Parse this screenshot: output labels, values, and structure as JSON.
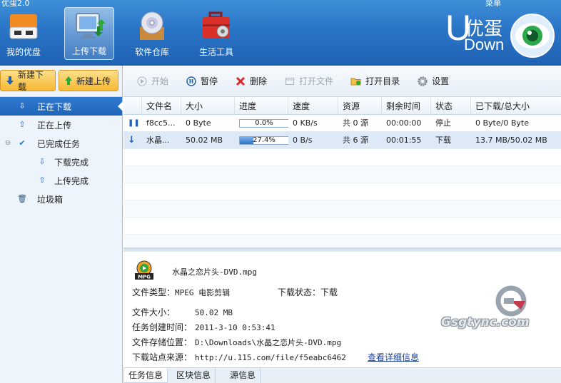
{
  "app": {
    "title": "优蛋2.0",
    "menu_label": "菜单"
  },
  "nav": [
    {
      "label": "我的优盘",
      "icon": "usb-drive-icon"
    },
    {
      "label": "上传下载",
      "icon": "monitor-transfer-icon",
      "active": true
    },
    {
      "label": "软件仓库",
      "icon": "disc-box-icon"
    },
    {
      "label": "生活工具",
      "icon": "toolbox-icon"
    }
  ],
  "logo": {
    "u": "U",
    "cn": "优蛋",
    "down": "Down"
  },
  "left": {
    "new_download": "新建下载",
    "new_upload": "新建上传",
    "tree": [
      {
        "label": "正在下载",
        "icon": "download-arrow-icon",
        "selected": true
      },
      {
        "label": "正在上传",
        "icon": "upload-arrow-icon"
      },
      {
        "label": "已完成任务",
        "icon": "check-icon"
      },
      {
        "label": "下载完成",
        "icon": "download-done-icon"
      },
      {
        "label": "上传完成",
        "icon": "upload-done-icon"
      },
      {
        "label": "垃圾箱",
        "icon": "trash-icon"
      }
    ]
  },
  "toolbar": {
    "start": "开始",
    "pause": "暂停",
    "delete": "删除",
    "open_file": "打开文件",
    "open_dir": "打开目录",
    "settings": "设置"
  },
  "table": {
    "headers": [
      "文件名",
      "大小",
      "进度",
      "速度",
      "资源",
      "剩余时间",
      "状态",
      "已下载/总大小"
    ],
    "rows": [
      {
        "name": "f8cc5...",
        "size": "0 Byte",
        "progress": 0.0,
        "progress_text": "0.0%",
        "speed": "0 KB/s",
        "source": "共 0 源",
        "remaining": "00:00:00",
        "status": "停止",
        "downloaded": "0 Byte/0 Byte",
        "icon": "pause-icon"
      },
      {
        "name": "水晶...",
        "size": "50.02 MB",
        "progress": 27.4,
        "progress_text": "27.4%",
        "speed": "0 B/s",
        "source": "共 6 源",
        "remaining": "00:01:55",
        "status": "下载",
        "downloaded": "13.7 MB/50.02 MB",
        "icon": "download-arrow-icon"
      }
    ]
  },
  "detail": {
    "filename": "水晶之恋片头-DVD.mpg",
    "file_type_label": "文件类型：",
    "file_type": "MPEG 电影剪辑",
    "dl_status_label": "下载状态：",
    "dl_status": "下载",
    "size_label": "文件大小：",
    "size": "50.02 MB",
    "created_label": "任务创建时间：",
    "created": "2011-3-10 0:53:41",
    "location_label": "文件存储位置：",
    "location": "D:\\Downloads\\水晶之恋片头-DVD.mpg",
    "source_label": "下载站点来源：",
    "source": "http://u.115.com/file/f5eabc6462",
    "details_link": "查看详细信息"
  },
  "bottom_tabs": [
    "任务信息",
    "区块信息",
    "源信息"
  ],
  "watermark": "Gsgtync.com",
  "colors": {
    "banner": "#2a74c6",
    "accent": "#1f64b8",
    "button": "#f6b832"
  }
}
